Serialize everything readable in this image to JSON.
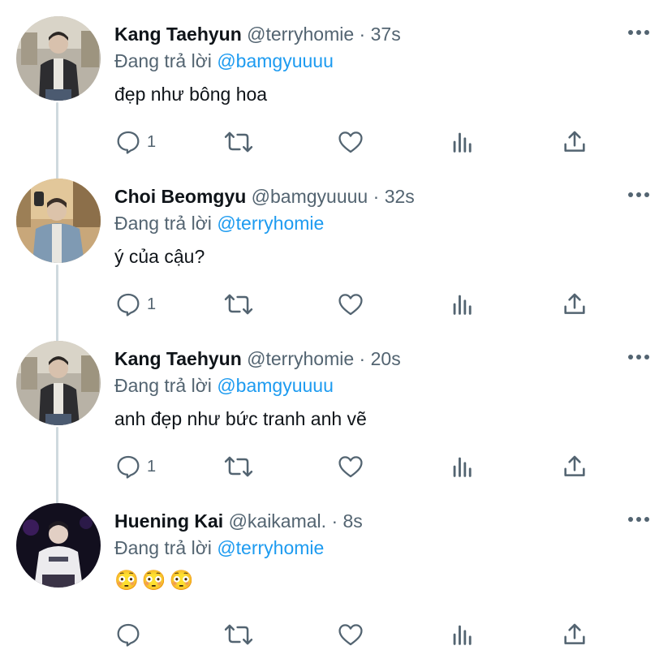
{
  "colors": {
    "link": "#1d9bf0",
    "muted": "#536471",
    "text": "#0f1419",
    "thread_line": "#cfd9de"
  },
  "tweets": [
    {
      "name": "Kang Taehyun",
      "handle": "@terryhomie",
      "separator": "·",
      "time": "37s",
      "reply_prefix": "Đang trả lời",
      "reply_to": "@bamgyuuuu",
      "text": "đẹp như bông hoa",
      "reply_count": "1",
      "avatar_icon": "avatar-photo"
    },
    {
      "name": "Choi Beomgyu",
      "handle": "@bamgyuuuu",
      "separator": "·",
      "time": "32s",
      "reply_prefix": "Đang trả lời",
      "reply_to": "@terryhomie",
      "text": "ý của cậu?",
      "reply_count": "1",
      "avatar_icon": "avatar-photo"
    },
    {
      "name": "Kang Taehyun",
      "handle": "@terryhomie",
      "separator": "·",
      "time": "20s",
      "reply_prefix": "Đang trả lời",
      "reply_to": "@bamgyuuuu",
      "text": "anh đẹp như bức tranh anh vẽ",
      "reply_count": "1",
      "avatar_icon": "avatar-photo"
    },
    {
      "name": "Huening Kai",
      "handle": "@kaikamal.",
      "separator": "·",
      "time": "8s",
      "reply_prefix": "Đang trả lời",
      "reply_to": "@terryhomie",
      "text": "😳😳😳",
      "reply_count": "",
      "avatar_icon": "avatar-photo"
    }
  ]
}
